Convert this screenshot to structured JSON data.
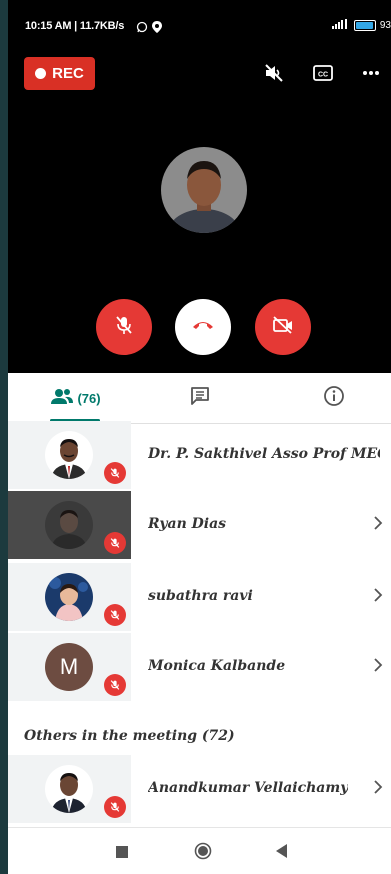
{
  "status_bar": {
    "time": "10:15 AM | 11.7KB/s",
    "battery": "93"
  },
  "call": {
    "rec_label": "REC"
  },
  "tabs": {
    "people_count": "(76)"
  },
  "participants": [
    {
      "name": "Dr. P. Sakthivel Asso Prof MECH (Y..."
    },
    {
      "name": "Ryan Dias"
    },
    {
      "name": "subathra ravi"
    },
    {
      "name": "Monica Kalbande",
      "initial": "M"
    }
  ],
  "others": {
    "label": "Others in the meeting (72)",
    "participants": [
      {
        "name": "Anandkumar Vellaichamy"
      }
    ]
  },
  "colors": {
    "accent": "#00796b",
    "danger": "#e53935",
    "rec": "#d93025"
  },
  "icons": [
    "whatsapp-icon",
    "location-icon",
    "signal-icon",
    "battery-icon",
    "speaker-off-icon",
    "captions-icon",
    "more-icon",
    "mic-off-icon",
    "end-call-icon",
    "video-off-icon",
    "people-icon",
    "chat-icon",
    "info-icon",
    "chevron-right-icon",
    "square-nav-icon",
    "home-nav-icon",
    "back-nav-icon"
  ]
}
